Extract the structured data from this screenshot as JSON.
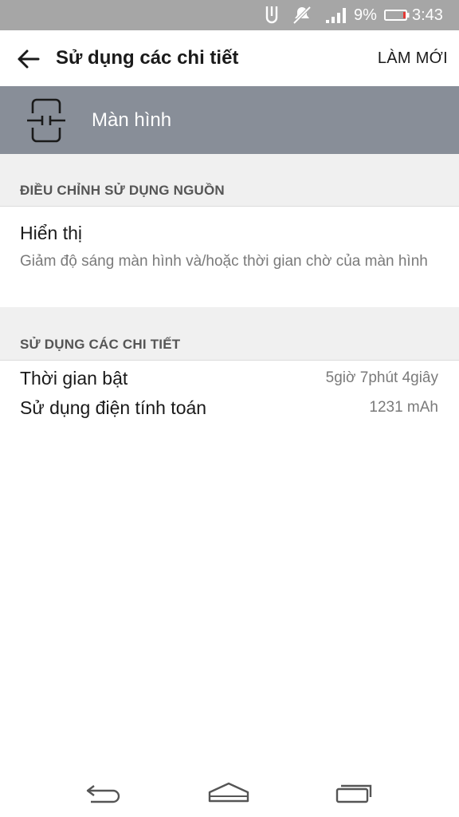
{
  "status_bar": {
    "battery_percent": "9%",
    "time": "3:43",
    "icons": [
      "usb-icon",
      "mute-icon",
      "signal-icon",
      "battery-icon"
    ]
  },
  "app_bar": {
    "title": "Sử dụng các chi tiết",
    "refresh_label": "LÀM MỚI",
    "back_icon": "arrow-back-icon"
  },
  "component": {
    "label": "Màn hình",
    "icon": "screen-icon",
    "banner_color": "#888e98"
  },
  "power_section": {
    "header": "ĐIỀU CHỈNH SỬ DỤNG NGUỒN",
    "item": {
      "title": "Hiển thị",
      "description": "Giảm độ sáng màn hình và/hoặc thời gian chờ của màn hình"
    }
  },
  "details_section": {
    "header": "SỬ DỤNG CÁC CHI TIẾT",
    "rows": [
      {
        "label": "Thời gian bật",
        "value": "5giờ 7phút 4giây"
      },
      {
        "label": "Sử dụng điện tính toán",
        "value": "1231 mAh"
      }
    ]
  },
  "nav_bar": {
    "icons": [
      "nav-back-icon",
      "nav-home-icon",
      "nav-recents-icon"
    ]
  }
}
